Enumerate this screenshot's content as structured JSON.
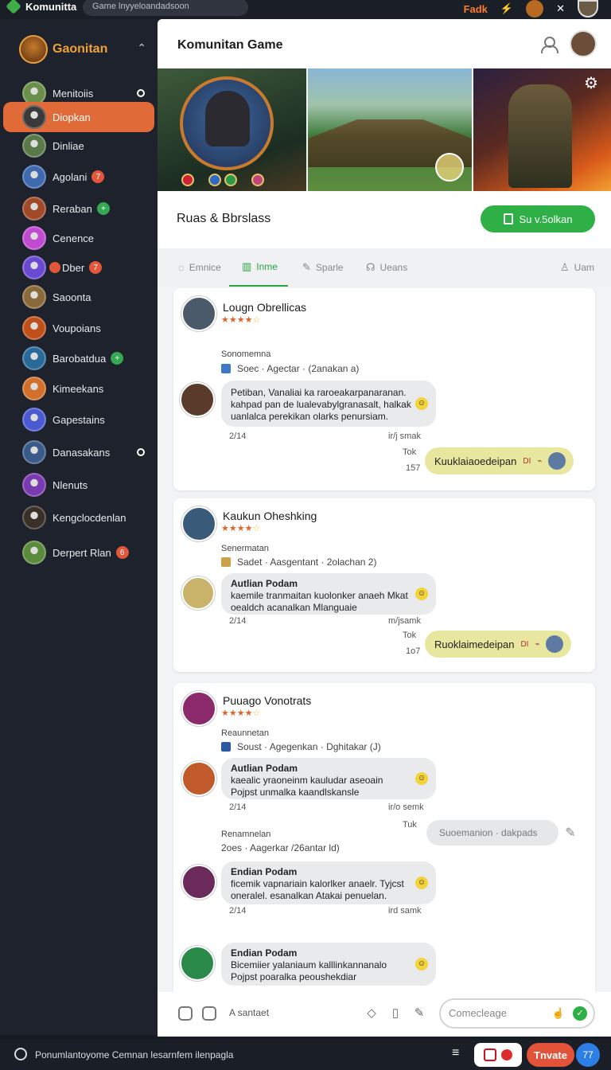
{
  "topbar": {
    "brand": "Komunitta",
    "search_placeholder": "Game lnyyeloandadsoon",
    "fire_label": "Fadk",
    "lightning_glyph": "⚡",
    "close_glyph": "✕"
  },
  "sidebar": {
    "title": "Gaonitan",
    "caret": "⌃",
    "items": [
      {
        "label": "Menitoiis",
        "color": "#6a8f4a",
        "dot": true
      },
      {
        "label": "Diopkan",
        "color": "#3a3a3a",
        "active": true
      },
      {
        "label": "Dinliae",
        "color": "#5a7a4a"
      },
      {
        "label": "Agolani",
        "color": "#3f6ab0",
        "badge": "7",
        "badge_color": "orange"
      },
      {
        "label": "Reraban",
        "color": "#a04a2a",
        "badge": "+",
        "badge_color": "green"
      },
      {
        "label": "Cenence",
        "color": "#c04ad0"
      },
      {
        "label": "Dber",
        "color": "#6a4ad0",
        "badge": "7",
        "badge_color": "orange",
        "prefix_dot": true
      },
      {
        "label": "Saoonta",
        "color": "#8a6a3a"
      },
      {
        "label": "Voupoians",
        "color": "#c0501a"
      },
      {
        "label": "Barobatdua",
        "color": "#2a6a9a",
        "badge": "+",
        "badge_color": "green"
      },
      {
        "label": "Kimeekans",
        "color": "#d0702a"
      },
      {
        "label": "Gapestains",
        "color": "#4a5ad0"
      },
      {
        "label": "Danasakans",
        "color": "#3a5a8a",
        "dot": true
      },
      {
        "label": "Nlenuts",
        "color": "#7a3ab0"
      },
      {
        "label": "Kengclocdenlan",
        "color": "#3a3028"
      },
      {
        "label": "Derpert Rlan",
        "color": "#5a8a3a",
        "badge": "6",
        "badge_color": "orange"
      }
    ]
  },
  "main": {
    "title": "Komunitan Game",
    "subtitle": "Ruas & Bbrslass",
    "cta_label": "Su v.5olkan",
    "tabs": [
      {
        "label": "Emnice",
        "icon": "◌"
      },
      {
        "label": "Inme",
        "icon": "▥",
        "active": true
      },
      {
        "label": "Sparle",
        "icon": "✎"
      },
      {
        "label": "Ueans",
        "icon": "☊"
      },
      {
        "label": "Uam",
        "icon": "♙"
      }
    ]
  },
  "posts": [
    {
      "author": "Lougn Obrellicas",
      "stars": "★★★★",
      "star_last": "☆",
      "section": "Sonomemna",
      "meta": "Soec  · Agectar · (2anakan a)",
      "message": "Petiban, Vanaliai ka raroeakarpanaranan. kahpad pan de lualevabylgranasalt, halkak uanlalca perekikan olarks penursiam.",
      "emoji": "☺",
      "time": "2/14",
      "action": "ir/j smak",
      "tuk": "Tok",
      "count": "157",
      "reply": "Kuuklaiaoedeipan",
      "reply_tag": "DI"
    },
    {
      "author": "Kaukun Oheshking",
      "stars": "★★★★",
      "star_last": "☆",
      "section": "Senermatan",
      "meta": "Sadet · Aasgentant  · 2olachan 2)",
      "subauthor": "Autlian Podam",
      "message": "kaemile tranmaitan kuolonker anaeh Mkat oealdch acanalkan Mlanguaie",
      "emoji": "☺",
      "time": "2/14",
      "action": "m/jsamk",
      "tuk": "Tok",
      "count": "1o7",
      "reply": "Ruoklaimedeipan",
      "reply_tag": "DI"
    },
    {
      "author": "Puuago Vonotrats",
      "stars": "★★★★",
      "star_last": "☆",
      "section": "Reaunnetan",
      "meta": "Soust  · Agegenkan  · Dghitakar (J)",
      "subauthor": "Autlian Podam",
      "message": "kaealic yraoneinm kauludar aseoain Pojpst unmalka kaandlskansle",
      "emoji": "☺",
      "time": "2/14",
      "action": "ir/o semk",
      "tuk": "Tuk",
      "suggest": "Suoemanion   · dakpads",
      "sub_section": "Renamnelan",
      "sub_meta": "2oes  · Aagerkar  /26antar ld)",
      "sub2": {
        "author": "Endian Podam",
        "message": "ficemik vapnariain kalorlker anaelr. Tyjcst oneralel. esanalkan Atakai penuelan.",
        "time": "2/14",
        "action": "ird samk"
      },
      "sub3": {
        "author": "Endian Podam",
        "message": "Bicemiier yalaniaum kalllinkannanalo Pojpst poaralka peoushekdiar"
      }
    }
  ],
  "composer": {
    "label": "A santaet",
    "placeholder": "Comecleage"
  },
  "footer": {
    "text": "Ponumlantoyome  Cemnan lesarnfem ilenpagla",
    "button": "Tnvate",
    "blue": "77"
  }
}
